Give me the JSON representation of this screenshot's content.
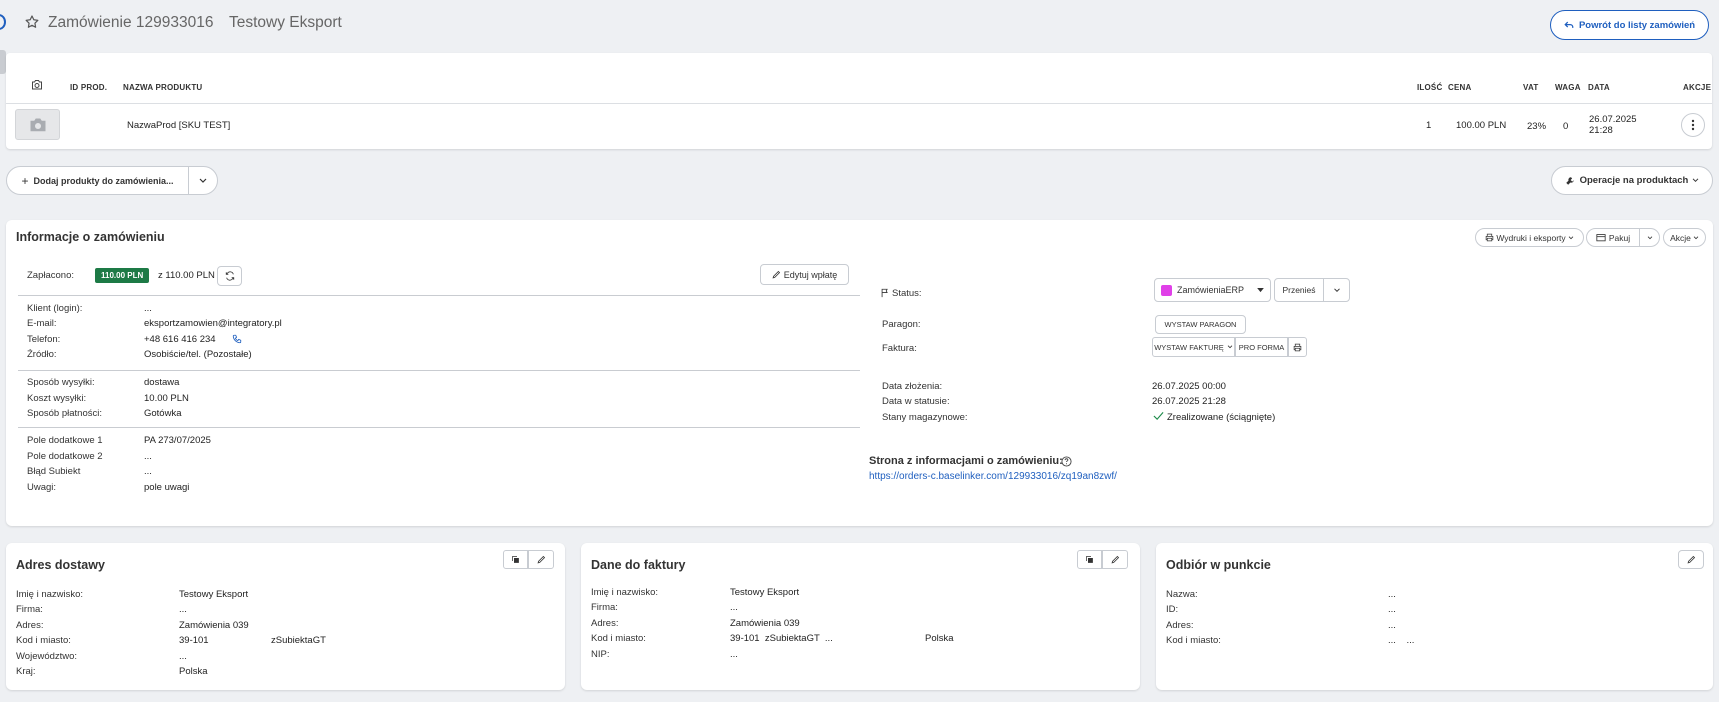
{
  "header": {
    "order_title": "Zamówienie 129933016",
    "order_subtitle": "Testowy Eksport",
    "back_button": "Powrót do listy zamówień"
  },
  "products_table": {
    "columns": [
      "ID PROD.",
      "NAZWA PRODUKTU",
      "ILOŚĆ",
      "CENA",
      "VAT",
      "WAGA",
      "DATA",
      "AKCJE"
    ],
    "rows": [
      {
        "id": "",
        "name": "NazwaProd [SKU TEST]",
        "qty": "1",
        "price": "100.00 PLN",
        "vat": "23%",
        "weight": "0",
        "date_line1": "26.07.2025",
        "date_line2": "21:28"
      }
    ]
  },
  "actions": {
    "add_products": "Dodaj produkty do zamówienia...",
    "product_operations": "Operacje na produktach"
  },
  "order_info": {
    "title": "Informacje o zamówieniu",
    "buttons": {
      "prints": "Wydruki i eksporty",
      "pack": "Pakuj",
      "actions": "Akcje"
    },
    "paid_label": "Zapłacono:",
    "paid_amount": "110.00 PLN",
    "paid_total": "z 110.00 PLN",
    "edit_payment": "Edytuj wpłatę",
    "client_fields": [
      {
        "label": "Klient (login):",
        "value": "..."
      },
      {
        "label": "E-mail:",
        "value": "eksportzamowien@integratory.pl"
      },
      {
        "label": "Telefon:",
        "value": "+48 616 416 234"
      },
      {
        "label": "Źródło:",
        "value": "Osobiście/tel. (Pozostałe)"
      }
    ],
    "shipping_fields": [
      {
        "label": "Sposób wysyłki:",
        "value": "dostawa"
      },
      {
        "label": "Koszt wysyłki:",
        "value": "10.00 PLN"
      },
      {
        "label": "Sposób płatności:",
        "value": "Gotówka"
      }
    ],
    "extra_fields": [
      {
        "label": "Pole dodatkowe 1",
        "value": "PA 273/07/2025"
      },
      {
        "label": "Pole dodatkowe 2",
        "value": "..."
      },
      {
        "label": "Błąd Subiekt",
        "value": "..."
      },
      {
        "label": "Uwagi:",
        "value": "pole uwagi"
      }
    ],
    "status_label": "Status:",
    "status_value": "ZamówieniaERP",
    "status_color": "#e040e8",
    "move_button": "Przenieś",
    "receipt_label": "Paragon:",
    "receipt_button": "WYSTAW PARAGON",
    "invoice_label": "Faktura:",
    "invoice_button": "WYSTAW FAKTURĘ",
    "proforma_button": "PRO FORMA",
    "date_fields": [
      {
        "label": "Data złożenia:",
        "value": "26.07.2025 00:00"
      },
      {
        "label": "Data w statusie:",
        "value": "26.07.2025 21:28"
      },
      {
        "label": "Stany magazynowe:",
        "value": "Zrealizowane (ściągnięte)"
      }
    ],
    "info_page_label": "Strona z informacjami o zamówieniu:",
    "info_page_link": "https://orders-c.baselinker.com/129933016/zq19an8zwf/"
  },
  "delivery": {
    "title": "Adres dostawy",
    "fields": [
      {
        "label": "Imię i nazwisko:",
        "value": "Testowy Eksport"
      },
      {
        "label": "Firma:",
        "value": "..."
      },
      {
        "label": "Adres:",
        "value": "Zamówienia 039"
      },
      {
        "label": "Kod i miasto:",
        "value": "39-101",
        "value2": "zSubiektaGT"
      },
      {
        "label": "Województwo:",
        "value": "..."
      },
      {
        "label": "Kraj:",
        "value": "Polska"
      }
    ]
  },
  "invoice": {
    "title": "Dane do faktury",
    "fields": [
      {
        "label": "Imię i nazwisko:",
        "value": "Testowy Eksport"
      },
      {
        "label": "Firma:",
        "value": "..."
      },
      {
        "label": "Adres:",
        "value": "Zamówienia 039"
      },
      {
        "label": "Kod i miasto:",
        "value": "39-101  zSubiektaGT  ...",
        "value2": "Polska"
      },
      {
        "label": "NIP:",
        "value": "..."
      }
    ]
  },
  "pickup": {
    "title": "Odbiór w punkcie",
    "fields": [
      {
        "label": "Nazwa:",
        "value": "..."
      },
      {
        "label": "ID:",
        "value": "..."
      },
      {
        "label": "Adres:",
        "value": "..."
      },
      {
        "label": "Kod i miasto:",
        "value": "...    ..."
      }
    ]
  },
  "colors": {
    "accent": "#1f5fbf",
    "paid_badge": "#1d7a46",
    "link": "#1f5fbf"
  }
}
